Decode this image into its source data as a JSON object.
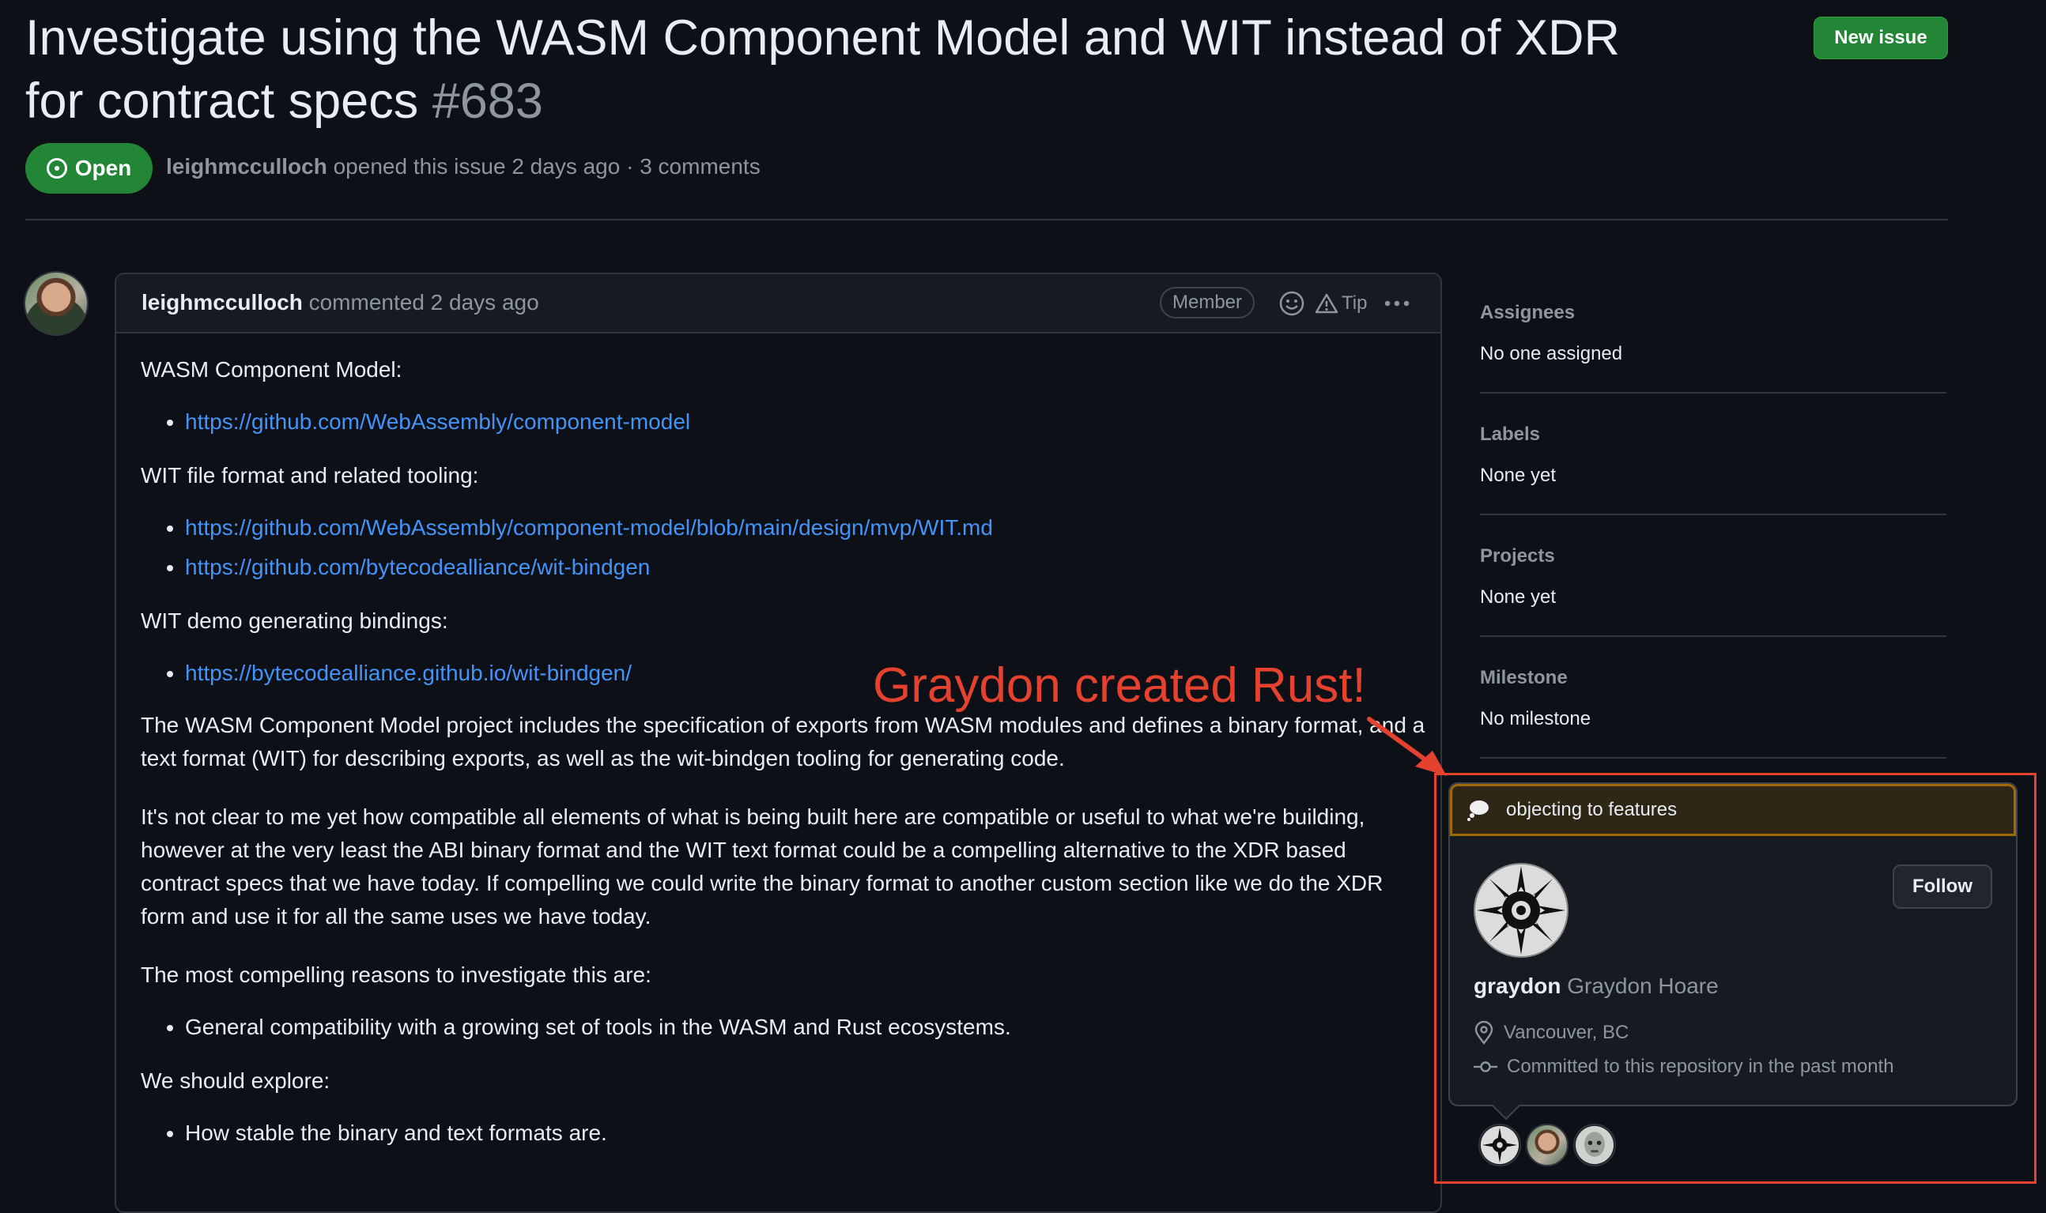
{
  "issue": {
    "title": "Investigate using the WASM Component Model and WIT instead of XDR for contract specs",
    "number": "#683",
    "state": "Open",
    "author": "leighmcculloch",
    "meta_suffix": "opened this issue 2 days ago · 3 comments"
  },
  "header": {
    "new_issue_label": "New issue"
  },
  "comment": {
    "author": "leighmcculloch",
    "action": "commented 2 days ago",
    "role_badge": "Member",
    "tip_label": "Tip",
    "body": {
      "h1": "WASM Component Model:",
      "links1": [
        "https://github.com/WebAssembly/component-model"
      ],
      "h2": "WIT file format and related tooling:",
      "links2": [
        "https://github.com/WebAssembly/component-model/blob/main/design/mvp/WIT.md",
        "https://github.com/bytecodealliance/wit-bindgen"
      ],
      "h3": "WIT demo generating bindings:",
      "links3": [
        "https://bytecodealliance.github.io/wit-bindgen/"
      ],
      "p1": "The WASM Component Model project includes the specification of exports from WASM modules and defines a binary format, and a text format (WIT) for describing exports, as well as the wit-bindgen tooling for generating code.",
      "p2": "It's not clear to me yet how compatible all elements of what is being built here are compatible or useful to what we're building, however at the very least the ABI binary format and the WIT text format could be a compelling alternative to the XDR based contract specs that we have today. If compelling we could write the binary format to another custom section like we do the XDR form and use it for all the same uses we have today.",
      "h4": "The most compelling reasons to investigate this are:",
      "reasons": [
        "General compatibility with a growing set of tools in the WASM and Rust ecosystems."
      ],
      "h5": "We should explore:",
      "explore": [
        "How stable the binary and text formats are."
      ]
    }
  },
  "sidebar": {
    "assignees": {
      "label": "Assignees",
      "value": "No one assigned"
    },
    "labels": {
      "label": "Labels",
      "value": "None yet"
    },
    "projects": {
      "label": "Projects",
      "value": "None yet"
    },
    "milestone": {
      "label": "Milestone",
      "value": "No milestone"
    }
  },
  "annotation": {
    "text": "Graydon created Rust!",
    "color": "#e5412f"
  },
  "hovercard": {
    "status": "objecting to features",
    "follow_label": "Follow",
    "login": "graydon",
    "full_name": "Graydon Hoare",
    "location": "Vancouver, BC",
    "activity": "Committed to this repository in the past month"
  },
  "colors": {
    "accent_green": "#238636",
    "link_blue": "#4493f8",
    "background": "#0d1117"
  }
}
